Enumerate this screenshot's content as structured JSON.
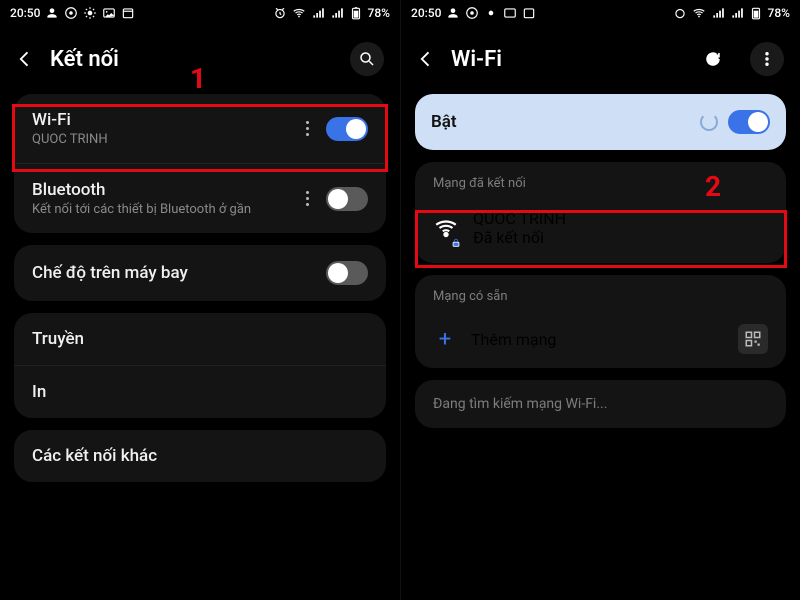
{
  "status": {
    "time": "20:50",
    "battery": "78%"
  },
  "left": {
    "title": "Kết nối",
    "annotation": "1",
    "items": {
      "wifi": {
        "title": "Wi-Fi",
        "subtitle": "QUOC TRINH",
        "on": true
      },
      "bluetooth": {
        "title": "Bluetooth",
        "subtitle": "Kết nối tới các thiết bị Bluetooth ở gần",
        "on": false
      },
      "airplane": {
        "title": "Chế độ trên máy bay",
        "on": false
      },
      "cast": {
        "title": "Truyền"
      },
      "print": {
        "title": "In"
      },
      "more": {
        "title": "Các kết nối khác"
      }
    }
  },
  "right": {
    "title": "Wi-Fi",
    "annotation": "2",
    "on_label": "Bật",
    "connected_label": "Mạng đã kết nối",
    "network": {
      "name": "QUOC TRINH",
      "status": "Đã kết nối"
    },
    "available_label": "Mạng có sẵn",
    "add_network": "Thêm mạng",
    "scanning": "Đang tìm kiếm mạng Wi-Fi..."
  }
}
